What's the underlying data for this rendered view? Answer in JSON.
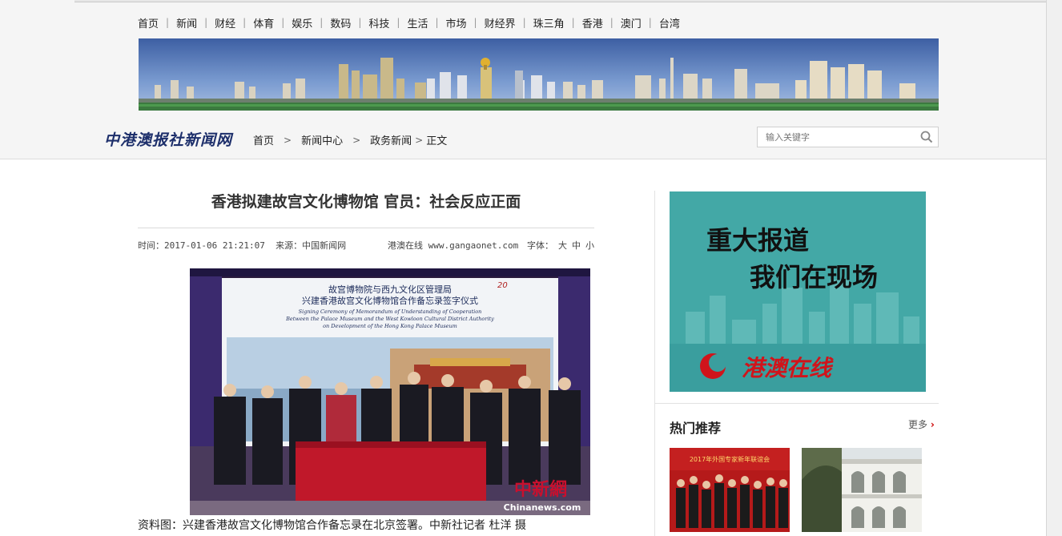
{
  "top_nav": [
    "首页",
    "新闻",
    "财经",
    "体育",
    "娱乐",
    "数码",
    "科技",
    "生活",
    "市场",
    "财经界",
    "珠三角",
    "香港",
    "澳门",
    "台湾"
  ],
  "logo": "中港澳报社新闻网",
  "breadcrumb": {
    "home": "首页",
    "section": "新闻中心",
    "category": "政务新闻",
    "current": "正文"
  },
  "search": {
    "placeholder": "输入关键字"
  },
  "article": {
    "title": "香港拟建故宫文化博物馆 官员：社会反应正面",
    "time": "时间：2017-01-06 21:21:07",
    "source": "来源：中国新闻网",
    "site": "港澳在线 www.gangaonet.com",
    "font_label": "字体：",
    "font_large": "大",
    "font_medium": "中",
    "font_small": "小",
    "caption": "资料图：兴建香港故宫文化博物馆合作备忘录在北京签署。中新社记者 杜洋 摄",
    "photo": {
      "banner_cn_1": "故宫博物院与西九文化区管理局",
      "banner_cn_2": "兴建香港故宫文化博物馆合作备忘录签字仪式",
      "banner_en_1": "Signing Ceremony of Memorandum of Understanding of Cooperation",
      "banner_en_2": "Between the Palace Museum and the West Kowloon Cultural District Authority",
      "banner_en_3": "on Development of the Hong Kong Palace Museum",
      "banner_badge": "20",
      "watermark_cn": "中新網",
      "watermark_en": "Chinanews.com"
    }
  },
  "sidebar": {
    "ad_line1": "重大报道",
    "ad_line2": "我们在现场",
    "ad_brand": "港澳在线",
    "hot_title": "热门推荐",
    "more": "更多",
    "thumb1_text": "2017年外国专家新年联谊会"
  },
  "colors": {
    "ad_teal": "#3a9e9e",
    "ad_brand_red": "#d0141b",
    "logo_navy": "#1d2f6b",
    "more_arrow": "#cc0000"
  }
}
